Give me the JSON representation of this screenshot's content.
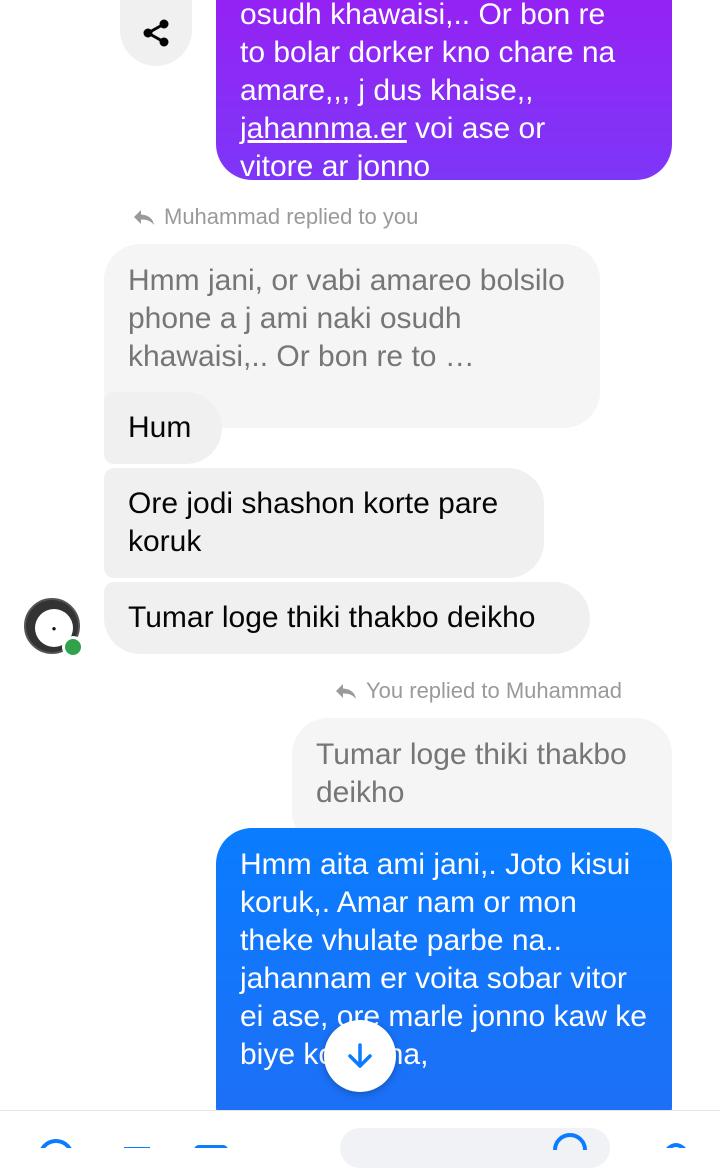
{
  "colors": {
    "sent_purple": "#8a2cf6",
    "sent_blue": "#1877f2",
    "received_bg": "#f0f0f0",
    "online": "#31a24c",
    "accent": "#0a7cff"
  },
  "thread": {
    "top_sent": {
      "line1": "osudh khawaisi,.. Or bon re",
      "line2": "to bolar dorker kno chare na",
      "line3": "amare,,,  j dus khaise,,",
      "link": "jahannma.er",
      "line4_rest": " voi ase or",
      "line5": "vitore ar jonno"
    },
    "reply_to_you": {
      "label": "Muhammad replied to you",
      "quoted_text": "Hmm jani,  or vabi amareo bolsilo phone a j ami naki osudh khawaisi,.. Or bon re to …"
    },
    "received_messages": [
      {
        "text": "Hum"
      },
      {
        "text": "Ore jodi shashon korte pare koruk"
      },
      {
        "text": "Tumar loge thiki thakbo deikho"
      }
    ],
    "you_replied": {
      "label": "You replied to Muhammad",
      "quoted_text": "Tumar loge thiki thakbo deikho"
    },
    "sent_blue_text": "Hmm aita ami jani,. Joto kisui koruk,. Amar nam or mon theke vhulate parbe na..  jahannam er voita sobar vitor ei ase,  ore marle jonno kaw ke biye korbe na,"
  },
  "icons": {
    "share": "share-icon",
    "reply": "reply-arrow-icon",
    "scroll_down": "arrow-down-icon",
    "avatar": "contact-avatar"
  }
}
